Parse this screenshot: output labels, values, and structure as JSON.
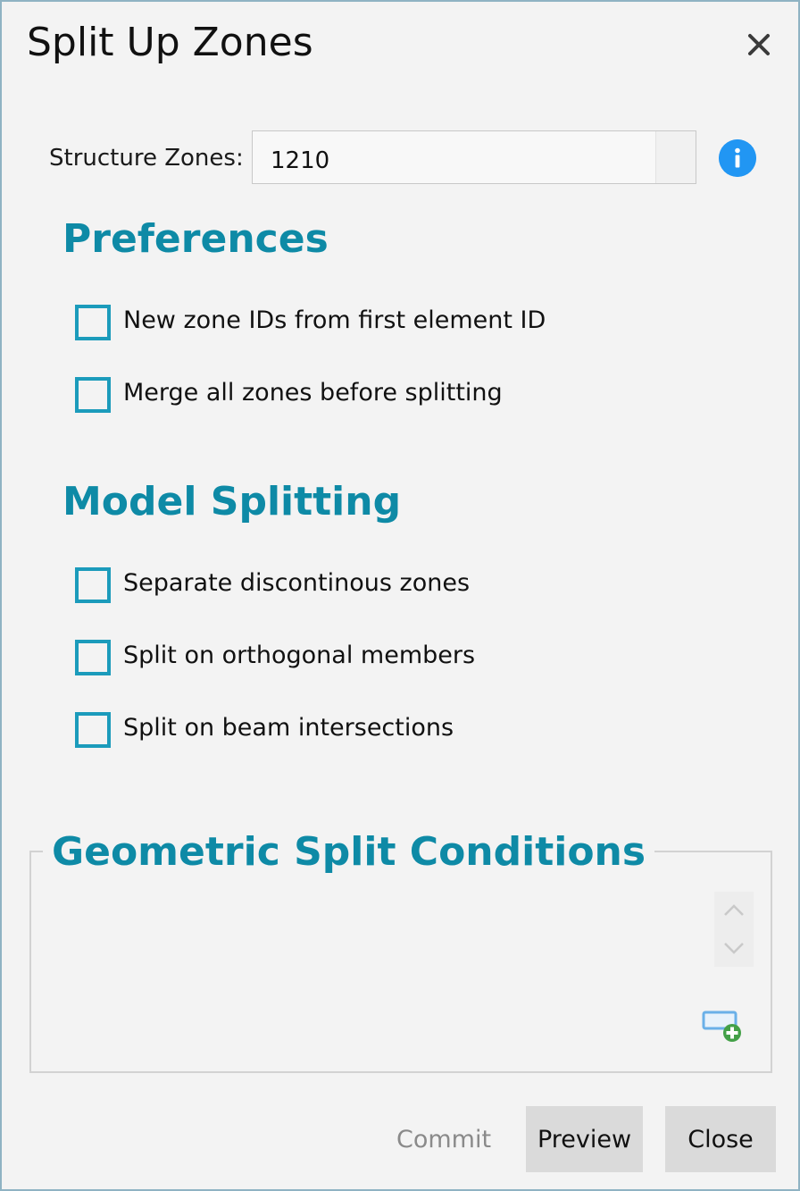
{
  "dialog": {
    "title": "Split Up Zones",
    "close_icon": "close-icon"
  },
  "structure_zones": {
    "label": "Structure Zones:",
    "value": "1210",
    "info_icon": "info-icon"
  },
  "preferences": {
    "heading": "Preferences",
    "options": [
      {
        "label": "New zone IDs from first element ID",
        "checked": false
      },
      {
        "label": "Merge all zones before splitting",
        "checked": false
      }
    ]
  },
  "model_splitting": {
    "heading": "Model Splitting",
    "options": [
      {
        "label": "Separate discontinous zones",
        "checked": false
      },
      {
        "label": "Split on orthogonal members",
        "checked": false
      },
      {
        "label": "Split on beam intersections",
        "checked": false
      }
    ]
  },
  "geometric_split": {
    "heading": "Geometric Split Conditions",
    "add_icon": "add-condition-icon"
  },
  "footer": {
    "commit_label": "Commit",
    "preview_label": "Preview",
    "close_label": "Close"
  },
  "colors": {
    "accent": "#0e8aa6",
    "checkbox_border": "#1b9bbb",
    "info_blue": "#2196f3",
    "add_green": "#43a047"
  }
}
